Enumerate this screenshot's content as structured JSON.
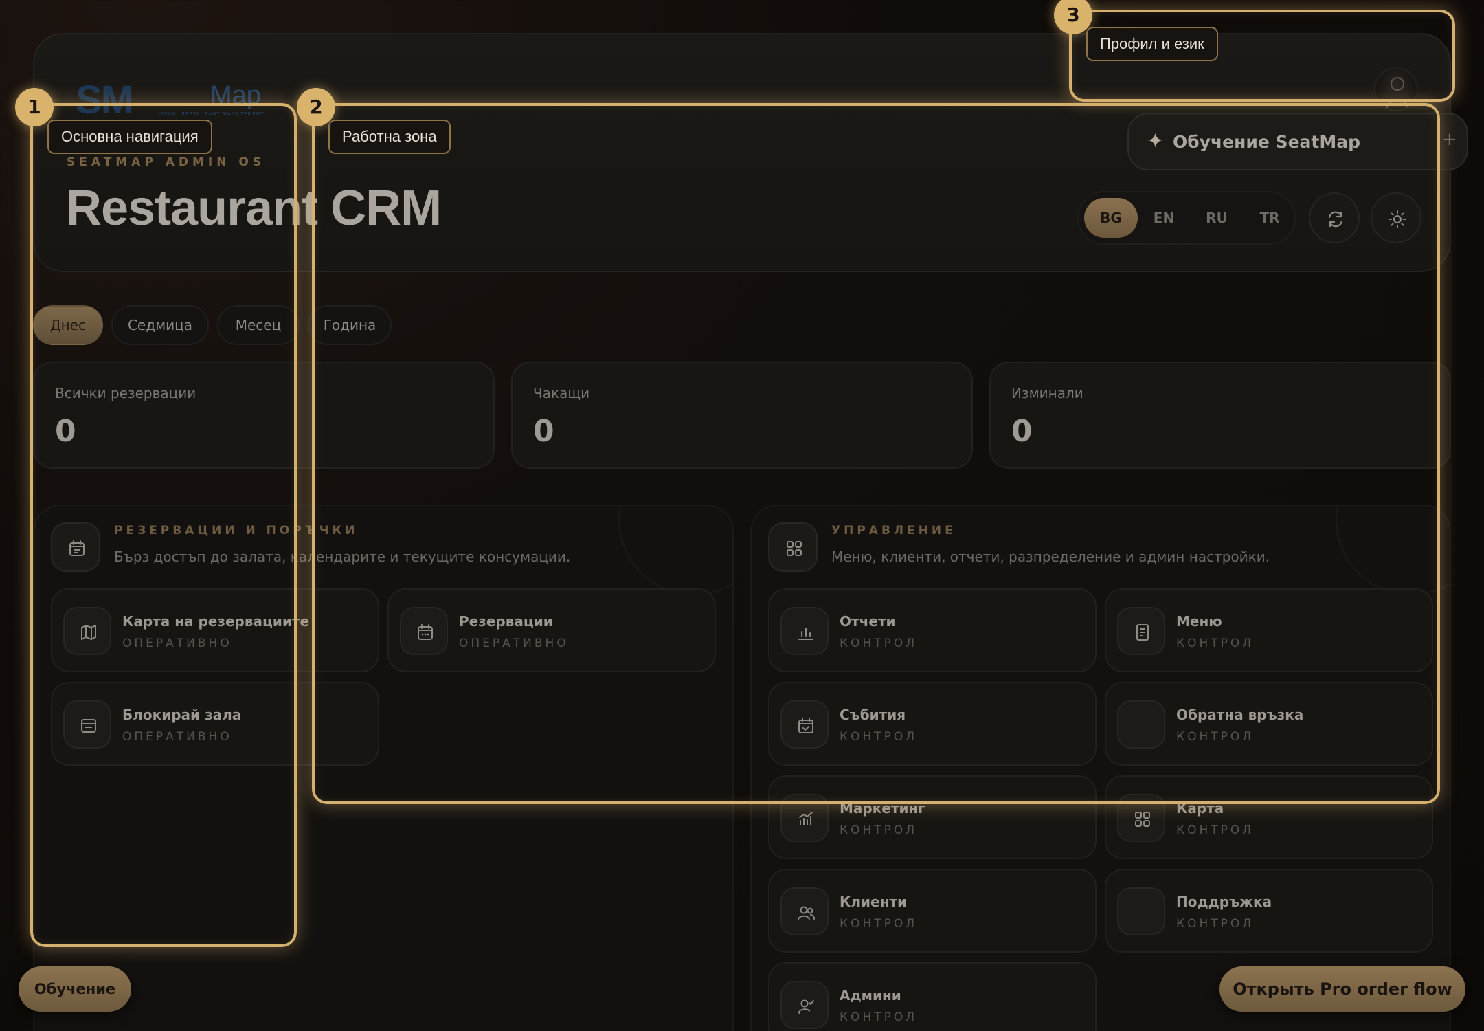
{
  "brand": {
    "logo_mark": "SM",
    "logo_word": "Map",
    "logo_sub": "VISUAL RESTAURANT MANAGEMENT",
    "eyebrow": "SEATMAP ADMIN OS",
    "title": "Restaurant CRM"
  },
  "header": {
    "training_label": "Обучение SeatMap",
    "training_plus": "+",
    "languages": [
      "BG",
      "EN",
      "RU",
      "TR"
    ],
    "active_language": "BG",
    "refresh_icon": "refresh-icon",
    "theme_icon": "sun-icon"
  },
  "periods": {
    "items": [
      "Днес",
      "Седмица",
      "Месец",
      "Година"
    ],
    "active": "Днес"
  },
  "stats": [
    {
      "label": "Всички резервации",
      "value": "0"
    },
    {
      "label": "Чакащи",
      "value": "0"
    },
    {
      "label": "Изминали",
      "value": "0"
    }
  ],
  "sections": {
    "reservations": {
      "title": "РЕЗЕРВАЦИИ И ПОРЪЧКИ",
      "description": "Бърз достъп до залата, календарите и текущите консумации.",
      "icon": "calendar-icon",
      "tiles": [
        {
          "name": "Карта на резервациите",
          "sub": "ОПЕРАТИВНО",
          "icon": "map-icon"
        },
        {
          "name": "Резервации",
          "sub": "ОПЕРАТИВНО",
          "icon": "calendar-icon"
        },
        {
          "name": "Блокирай зала",
          "sub": "ОПЕРАТИВНО",
          "icon": "block-icon"
        }
      ]
    },
    "management": {
      "title": "УПРАВЛЕНИЕ",
      "description": "Меню, клиенти, отчети, разпределение и админ настройки.",
      "icon": "grid-icon",
      "tiles": [
        {
          "name": "Отчети",
          "sub": "КОНТРОЛ",
          "icon": "chart-icon"
        },
        {
          "name": "Меню",
          "sub": "КОНТРОЛ",
          "icon": "menu-book-icon"
        },
        {
          "name": "Събития",
          "sub": "КОНТРОЛ",
          "icon": "event-icon"
        },
        {
          "name": "Обратна връзка",
          "sub": "КОНТРОЛ",
          "icon": ""
        },
        {
          "name": "Маркетинг",
          "sub": "КОНТРОЛ",
          "icon": "marketing-icon"
        },
        {
          "name": "Карта",
          "sub": "КОНТРОЛ",
          "icon": "grid-icon"
        },
        {
          "name": "Клиенти",
          "sub": "КОНТРОЛ",
          "icon": "users-icon"
        },
        {
          "name": "Поддръжка",
          "sub": "КОНТРОЛ",
          "icon": ""
        },
        {
          "name": "Админи",
          "sub": "КОНТРОЛ",
          "icon": "admin-icon"
        }
      ]
    }
  },
  "tour": {
    "steps": [
      {
        "number": "1",
        "label": "Основна навигация"
      },
      {
        "number": "2",
        "label": "Работна зона"
      },
      {
        "number": "3",
        "label": "Профил и език"
      }
    ]
  },
  "footer": {
    "training_button": "Обучение",
    "pro_button": "Открыть Pro order flow"
  },
  "colors": {
    "accent_gold": "#d5b06e",
    "active_chip": "#7d6749",
    "background": "#0f0c0a"
  }
}
